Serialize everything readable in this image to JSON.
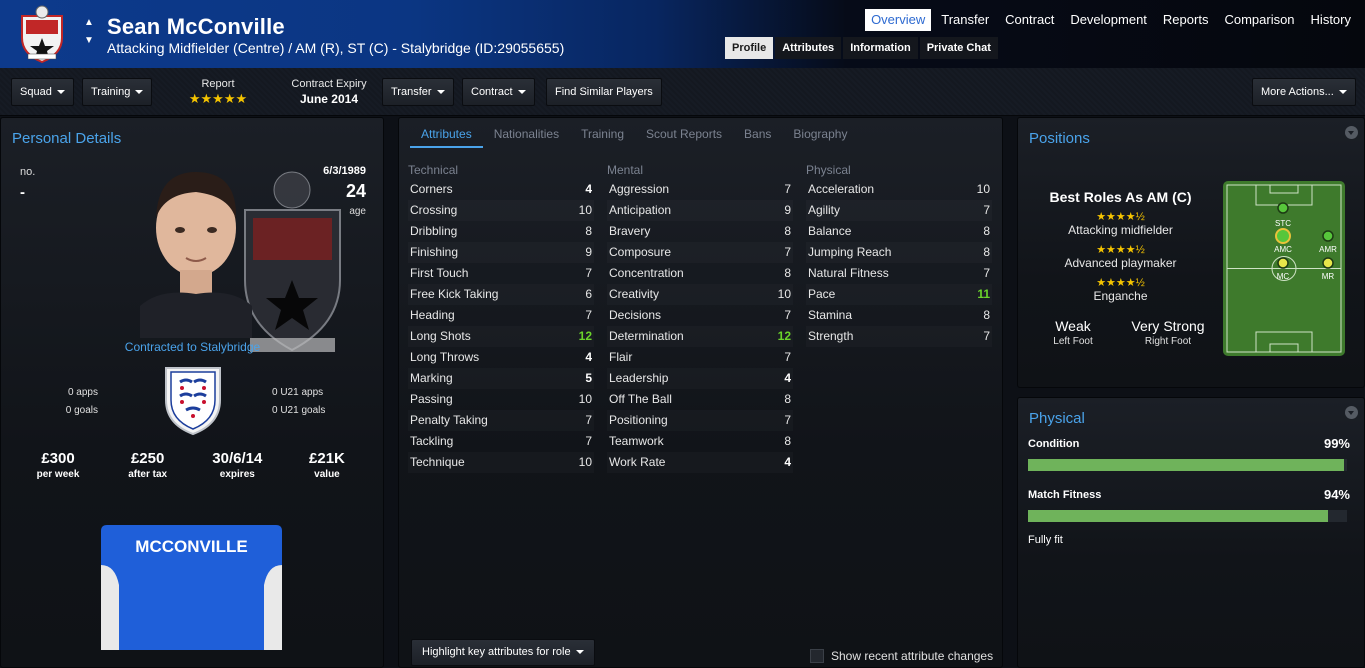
{
  "header": {
    "name": "Sean McConville",
    "subtitle": "Attacking Midfielder (Centre) / AM (R), ST (C) - Stalybridge (ID:29055655)",
    "main_tabs": [
      "Overview",
      "Transfer",
      "Contract",
      "Development",
      "Reports",
      "Comparison",
      "History"
    ],
    "sub_tabs": [
      "Profile",
      "Attributes",
      "Information",
      "Private Chat"
    ]
  },
  "toolbar": {
    "squad": "Squad",
    "training": "Training",
    "report_label": "Report",
    "report_stars": "★★★★★",
    "contract_label": "Contract Expiry",
    "contract_value": "June 2014",
    "transfer": "Transfer",
    "contract": "Contract",
    "find_similar": "Find Similar Players",
    "more_actions": "More Actions..."
  },
  "personal": {
    "title": "Personal Details",
    "no_label": "no.",
    "no_value": "-",
    "dob": "6/3/1989",
    "age": "24",
    "age_label": "age",
    "contracted": "Contracted to Stalybridge",
    "apps": "0 apps",
    "goals": "0 goals",
    "u21_apps": "0 U21 apps",
    "u21_goals": "0 U21 goals",
    "wage": "£300",
    "wage_label": "per week",
    "after_tax": "£250",
    "after_tax_label": "after tax",
    "expires": "30/6/14",
    "expires_label": "expires",
    "value": "£21K",
    "value_label": "value",
    "shirt_name": "MCCONVILLE"
  },
  "attributes": {
    "tabs": [
      "Attributes",
      "Nationalities",
      "Training",
      "Scout Reports",
      "Bans",
      "Biography"
    ],
    "technical_label": "Technical",
    "mental_label": "Mental",
    "physical_label": "Physical",
    "technical": [
      {
        "name": "Corners",
        "value": "4"
      },
      {
        "name": "Crossing",
        "value": "10"
      },
      {
        "name": "Dribbling",
        "value": "8"
      },
      {
        "name": "Finishing",
        "value": "9"
      },
      {
        "name": "First Touch",
        "value": "7"
      },
      {
        "name": "Free Kick Taking",
        "value": "6"
      },
      {
        "name": "Heading",
        "value": "7"
      },
      {
        "name": "Long Shots",
        "value": "12"
      },
      {
        "name": "Long Throws",
        "value": "4"
      },
      {
        "name": "Marking",
        "value": "5"
      },
      {
        "name": "Passing",
        "value": "10"
      },
      {
        "name": "Penalty Taking",
        "value": "7"
      },
      {
        "name": "Tackling",
        "value": "7"
      },
      {
        "name": "Technique",
        "value": "10"
      }
    ],
    "mental": [
      {
        "name": "Aggression",
        "value": "7"
      },
      {
        "name": "Anticipation",
        "value": "9"
      },
      {
        "name": "Bravery",
        "value": "8"
      },
      {
        "name": "Composure",
        "value": "7"
      },
      {
        "name": "Concentration",
        "value": "8"
      },
      {
        "name": "Creativity",
        "value": "10"
      },
      {
        "name": "Decisions",
        "value": "7"
      },
      {
        "name": "Determination",
        "value": "12"
      },
      {
        "name": "Flair",
        "value": "7"
      },
      {
        "name": "Leadership",
        "value": "4"
      },
      {
        "name": "Off The Ball",
        "value": "8"
      },
      {
        "name": "Positioning",
        "value": "7"
      },
      {
        "name": "Teamwork",
        "value": "8"
      },
      {
        "name": "Work Rate",
        "value": "4"
      }
    ],
    "physical": [
      {
        "name": "Acceleration",
        "value": "10"
      },
      {
        "name": "Agility",
        "value": "7"
      },
      {
        "name": "Balance",
        "value": "8"
      },
      {
        "name": "Jumping Reach",
        "value": "8"
      },
      {
        "name": "Natural Fitness",
        "value": "7"
      },
      {
        "name": "Pace",
        "value": "11"
      },
      {
        "name": "Stamina",
        "value": "8"
      },
      {
        "name": "Strength",
        "value": "7"
      }
    ],
    "highlight_button": "Highlight key attributes for role",
    "show_recent": "Show recent attribute changes"
  },
  "positions": {
    "title": "Positions",
    "best_roles": "Best Roles As AM (C)",
    "roles": [
      {
        "stars": "★★★★½",
        "name": "Attacking midfielder"
      },
      {
        "stars": "★★★★½",
        "name": "Advanced playmaker"
      },
      {
        "stars": "★★★★½",
        "name": "Enganche"
      }
    ],
    "left_foot_value": "Weak",
    "left_foot_label": "Left Foot",
    "right_foot_value": "Very Strong",
    "right_foot_label": "Right Foot",
    "pitch_labels": [
      "STC",
      "AMC",
      "AMR",
      "MC",
      "MR"
    ]
  },
  "physical": {
    "title": "Physical",
    "condition_label": "Condition",
    "condition_value": "99%",
    "condition_fraction": 0.99,
    "match_fitness_label": "Match Fitness",
    "match_fitness_value": "94%",
    "match_fitness_fraction": 0.94,
    "fitness_status": "Fully fit"
  },
  "colors": {
    "accent": "#4aa3ea",
    "header_blue": "#0d3a8c",
    "star": "#f5c400",
    "highlight_green": "#6bd52b",
    "bar_green": "#6fb35b"
  }
}
